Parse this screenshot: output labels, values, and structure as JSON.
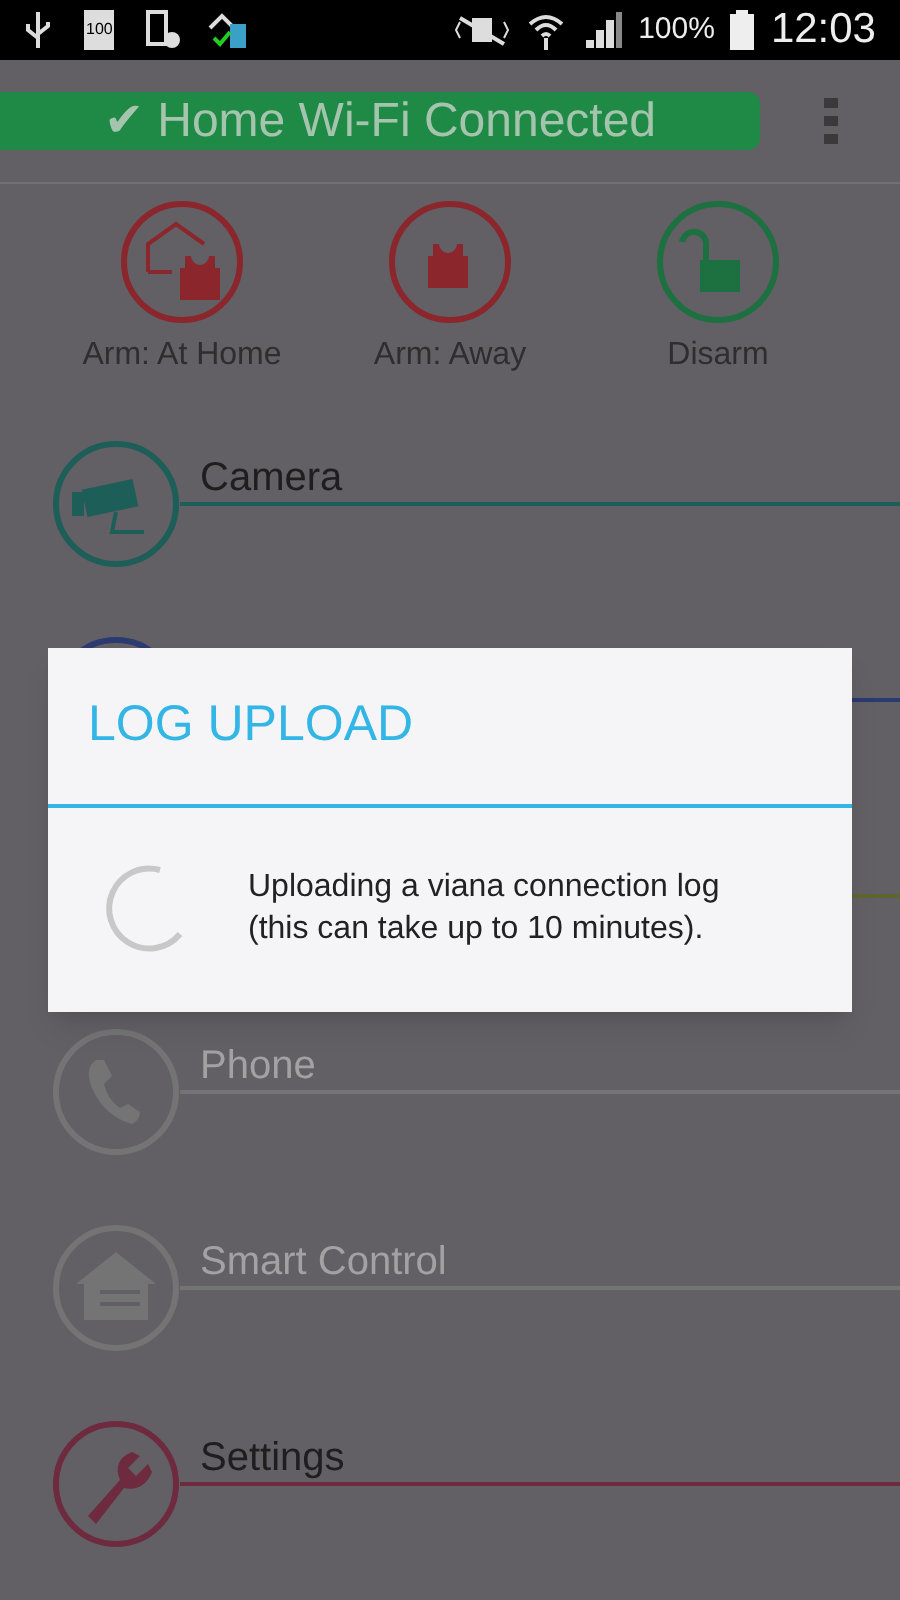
{
  "status_bar": {
    "battery_notice": "100",
    "battery": "100%",
    "time": "12:03"
  },
  "header": {
    "connection": "✔ Home Wi-Fi Connected"
  },
  "arm_buttons": [
    {
      "kind": "home",
      "label": "Arm: At Home",
      "color": "#8a262c"
    },
    {
      "kind": "away",
      "label": "Arm: Away",
      "color": "#8a262c"
    },
    {
      "kind": "disarm",
      "label": "Disarm",
      "color": "#1d7040"
    }
  ],
  "menu": [
    {
      "kind": "camera",
      "label": "Camera",
      "color": "#1e5e58",
      "disabled": false
    },
    {
      "kind": "blank",
      "color": "#2c3a72"
    },
    {
      "kind": "line",
      "color": "#5e6630"
    },
    {
      "kind": "phone",
      "label": "Phone",
      "color": "#747474",
      "disabled": true
    },
    {
      "kind": "smart",
      "label": "Smart Control",
      "color": "#747474",
      "disabled": true
    },
    {
      "kind": "settings",
      "label": "Settings",
      "color": "#6e2a3e",
      "disabled": false
    }
  ],
  "dialog": {
    "title": "LOG UPLOAD",
    "message": "Uploading a viana connection log (this can take up to 10 minutes)."
  }
}
